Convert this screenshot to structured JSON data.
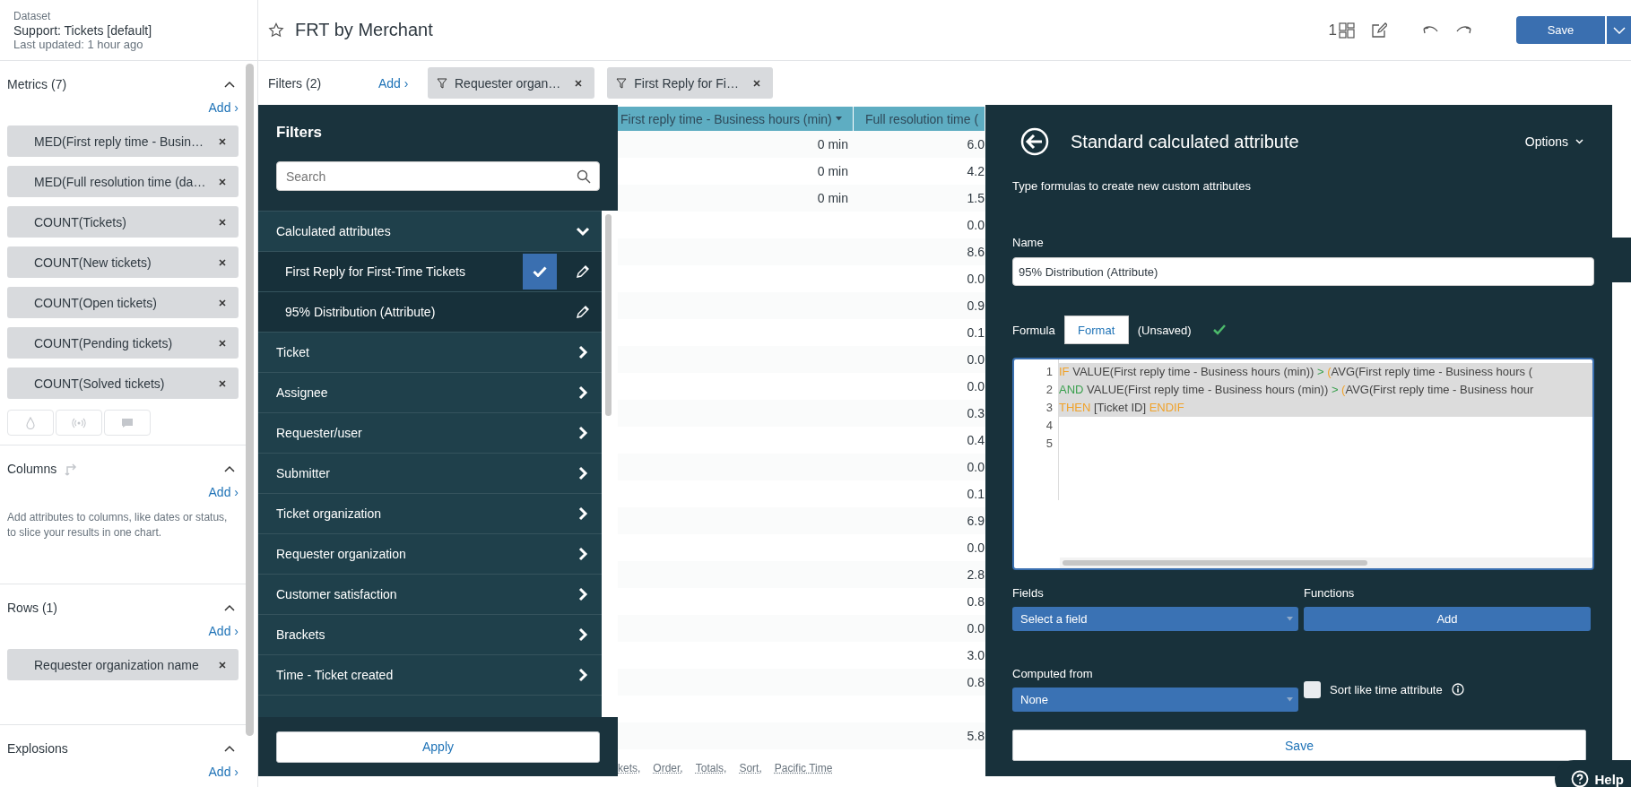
{
  "dataset": {
    "label": "Dataset",
    "name": "Support: Tickets [default]",
    "updated": "Last updated: 1 hour ago"
  },
  "sections": [
    {
      "kind": "metrics",
      "title": "Metrics (7)",
      "expanded": true,
      "add": "Add ›",
      "chips": [
        "MED(First reply time - Busin…",
        "MED(Full resolution time (da…",
        "COUNT(Tickets)",
        "COUNT(New tickets)",
        "COUNT(Open tickets)",
        "COUNT(Pending tickets)",
        "COUNT(Solved tickets)"
      ]
    },
    {
      "kind": "columns",
      "title": "Columns",
      "expanded": true,
      "add": "Add ›",
      "description": "Add attributes to columns, like dates or status, to slice your results in one chart."
    },
    {
      "kind": "rows",
      "title": "Rows (1)",
      "expanded": true,
      "add": "Add ›",
      "chips": [
        "Requester organization name"
      ]
    },
    {
      "kind": "explosions",
      "title": "Explosions",
      "expanded": true,
      "add": "Add ›"
    }
  ],
  "header": {
    "title": "FRT by Merchant",
    "layout_count": "1",
    "save": "Save"
  },
  "filter_bar": {
    "label": "Filters (2)",
    "add": "Add ›",
    "chips": [
      "Requester organ…",
      "First Reply for Fi…"
    ]
  },
  "filters_panel": {
    "title": "Filters",
    "search": {
      "placeholder": "Search"
    },
    "items": [
      {
        "label": "Calculated attributes",
        "expanded": true,
        "children": [
          {
            "label": "First Reply for First-Time Tickets",
            "checked": true
          },
          {
            "label": "95% Distribution (Attribute)",
            "checked": false
          }
        ]
      },
      {
        "label": "Ticket",
        "expanded": false
      },
      {
        "label": "Assignee",
        "expanded": false
      },
      {
        "label": "Requester/user",
        "expanded": false
      },
      {
        "label": "Submitter",
        "expanded": false
      },
      {
        "label": "Ticket organization",
        "expanded": false
      },
      {
        "label": "Requester organization",
        "expanded": false
      },
      {
        "label": "Customer satisfaction",
        "expanded": false
      },
      {
        "label": "Brackets",
        "expanded": false
      },
      {
        "label": "Time - Ticket created",
        "expanded": false
      }
    ],
    "apply": "Apply"
  },
  "table": {
    "columns": [
      {
        "label": "First reply time - Business hours (min)",
        "sorted": true
      },
      {
        "label": "Full resolution time (",
        "sorted": false
      }
    ],
    "rows": [
      [
        "0 min",
        "6.0"
      ],
      [
        "0 min",
        "4.2"
      ],
      [
        "0 min",
        "1.5"
      ],
      [
        null,
        "0.0"
      ],
      [
        null,
        "8.6"
      ],
      [
        null,
        "0.0"
      ],
      [
        null,
        "0.9"
      ],
      [
        null,
        "0.1"
      ],
      [
        null,
        "0.0"
      ],
      [
        null,
        "0.0"
      ],
      [
        null,
        "0.3"
      ],
      [
        null,
        "0.4"
      ],
      [
        null,
        "0.0"
      ],
      [
        null,
        "0.1"
      ],
      [
        null,
        "6.9"
      ],
      [
        null,
        "0.0"
      ],
      [
        null,
        "2.8"
      ],
      [
        null,
        "0.8"
      ],
      [
        null,
        "0.0"
      ],
      [
        null,
        "3.0"
      ],
      [
        null,
        "0.8"
      ],
      [
        null,
        null
      ],
      [
        null,
        "5.8"
      ]
    ],
    "footer": [
      "kets,",
      "Order,",
      "Totals,",
      "Sort,",
      "Pacific Time"
    ]
  },
  "calc_panel": {
    "title": "Standard calculated attribute",
    "options": "Options",
    "subtitle": "Type formulas to create new custom attributes",
    "name_label": "Name",
    "name_value": "95% Distribution (Attribute)",
    "formula_label": "Formula",
    "format": "Format",
    "status": "(Unsaved)",
    "valid": true,
    "lines": [
      {
        "number": "1",
        "selected": true,
        "tokens": [
          {
            "kind": "keyword",
            "text": "IF"
          },
          {
            "kind": "plain",
            "text": " VALUE(First reply time - Business hours (min)) "
          },
          {
            "kind": "operator",
            "text": ">"
          },
          {
            "kind": "keyword",
            "text": " ("
          },
          {
            "kind": "plain",
            "text": "AVG(First reply time - Business hours ("
          }
        ]
      },
      {
        "number": "2",
        "selected": true,
        "tokens": [
          {
            "kind": "operator",
            "text": "AND"
          },
          {
            "kind": "plain",
            "text": " VALUE(First reply time - Business hours (min)) "
          },
          {
            "kind": "operator",
            "text": ">"
          },
          {
            "kind": "keyword",
            "text": " ("
          },
          {
            "kind": "plain",
            "text": "AVG(First reply time - Business hour"
          }
        ]
      },
      {
        "number": "3",
        "selected": true,
        "tokens": [
          {
            "kind": "keyword",
            "text": "THEN"
          },
          {
            "kind": "plain",
            "text": " [Ticket ID] "
          },
          {
            "kind": "keyword",
            "text": "ENDIF"
          }
        ]
      },
      {
        "number": "4",
        "selected": false
      },
      {
        "number": "5",
        "selected": false
      }
    ],
    "fields_label": "Fields",
    "field_select": "Select a field",
    "functions_label": "Functions",
    "functions_add": "Add",
    "computed_label": "Computed from",
    "computed_select": "None",
    "sort_like_time": {
      "label": "Sort like time attribute",
      "checked": false
    },
    "save": "Save"
  },
  "help": "Help"
}
